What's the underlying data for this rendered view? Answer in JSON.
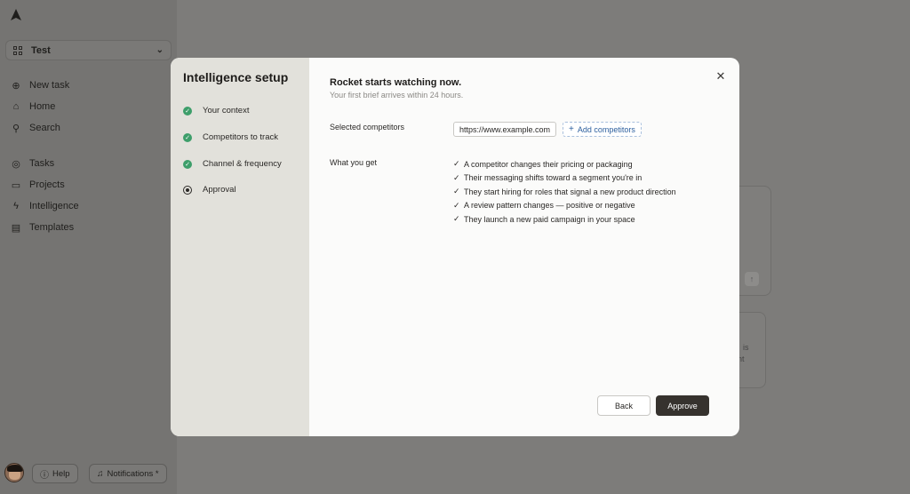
{
  "workspace": {
    "name": "Test"
  },
  "nav": [
    {
      "label": "New task",
      "icon": "plus-circle-icon"
    },
    {
      "label": "Home",
      "icon": "home-icon"
    },
    {
      "label": "Search",
      "icon": "search-icon"
    },
    {
      "label": "Tasks",
      "icon": "target-icon"
    },
    {
      "label": "Projects",
      "icon": "folder-icon"
    },
    {
      "label": "Intelligence",
      "icon": "bolt-icon"
    },
    {
      "label": "Templates",
      "icon": "template-icon"
    }
  ],
  "footer": {
    "help": "Help",
    "notifications": "Notifications *"
  },
  "background": {
    "text_a": "is",
    "text_b": "nt"
  },
  "modal": {
    "steps_title": "Intelligence setup",
    "steps": [
      {
        "label": "Your context",
        "status": "done"
      },
      {
        "label": "Competitors to track",
        "status": "done"
      },
      {
        "label": "Channel & frequency",
        "status": "done"
      },
      {
        "label": "Approval",
        "status": "current"
      }
    ],
    "title": "Rocket starts watching now.",
    "subtitle": "Your first brief arrives within 24 hours.",
    "competitors_label": "Selected competitors",
    "competitor_url": "https://www.example.com",
    "add_competitors": "Add competitors",
    "benefits_label": "What you get",
    "benefits": [
      "A competitor changes their pricing or packaging",
      "Their messaging shifts toward a segment you're in",
      "They start hiring for roles that signal a new product direction",
      "A review pattern changes — positive or negative",
      "They launch a new paid campaign in your space"
    ],
    "back": "Back",
    "approve": "Approve"
  },
  "colors": {
    "accent_green": "#3d9e6a",
    "primary_button": "#36322e",
    "link_blue": "#2d5f9e"
  }
}
